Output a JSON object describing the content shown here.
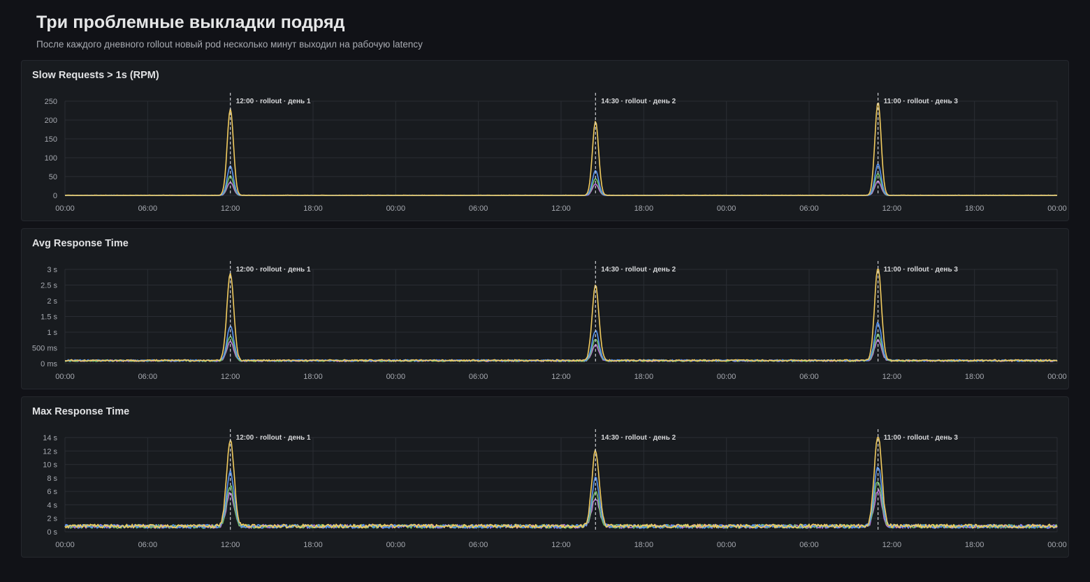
{
  "header": {
    "title": "Три проблемные выкладки подряд",
    "subtitle": "После каждого дневного rollout новый pod несколько минут выходил на рабочую latency"
  },
  "colors": {
    "background": "#111217",
    "panel": "#181b1f",
    "grid": "#2a2d33",
    "series": [
      "#f2cc60",
      "#5794f2",
      "#73bf69",
      "#b877d9"
    ]
  },
  "annotations": [
    {
      "x": 12,
      "label": "12:00 · rollout · день 1"
    },
    {
      "x": 38.5,
      "label": "14:30 · rollout · день 2"
    },
    {
      "x": 59,
      "label": "11:00 · rollout · день 3"
    }
  ],
  "x_ticks": [
    "00:00",
    "06:00",
    "12:00",
    "18:00",
    "00:00",
    "06:00",
    "12:00",
    "18:00",
    "00:00",
    "06:00",
    "12:00",
    "18:00",
    "00:00"
  ],
  "chart_data": [
    {
      "type": "line",
      "title": "Slow Requests > 1s (RPM)",
      "xlabel": "",
      "ylabel": "",
      "xlim": [
        0,
        72
      ],
      "ylim": [
        0,
        250
      ],
      "y_ticks": [
        {
          "v": 0,
          "label": "0"
        },
        {
          "v": 50,
          "label": "50"
        },
        {
          "v": 100,
          "label": "100"
        },
        {
          "v": 150,
          "label": "150"
        },
        {
          "v": 200,
          "label": "200"
        },
        {
          "v": 250,
          "label": "250"
        }
      ],
      "grid": true,
      "baseline": [
        0,
        0,
        0,
        0
      ],
      "noise": 0.6,
      "peaks": [
        [
          230,
          78,
          52,
          35
        ],
        [
          197,
          66,
          45,
          30
        ],
        [
          248,
          84,
          58,
          38
        ]
      ],
      "peak_width_h": 0.32
    },
    {
      "type": "line",
      "title": "Avg Response Time",
      "xlabel": "",
      "ylabel": "",
      "xlim": [
        0,
        72
      ],
      "ylim": [
        0,
        3
      ],
      "y_ticks": [
        {
          "v": 0,
          "label": "0 ms"
        },
        {
          "v": 0.5,
          "label": "500 ms"
        },
        {
          "v": 1,
          "label": "1 s"
        },
        {
          "v": 1.5,
          "label": "1.5 s"
        },
        {
          "v": 2,
          "label": "2 s"
        },
        {
          "v": 2.5,
          "label": "2.5 s"
        },
        {
          "v": 3,
          "label": "3 s"
        }
      ],
      "grid": true,
      "baseline": [
        0.1,
        0.1,
        0.09,
        0.09
      ],
      "noise": 0.025,
      "peaks": [
        [
          2.78,
          1.1,
          0.8,
          0.6
        ],
        [
          2.4,
          0.95,
          0.7,
          0.52
        ],
        [
          2.98,
          1.2,
          0.85,
          0.65
        ]
      ],
      "peak_width_h": 0.35
    },
    {
      "type": "line",
      "title": "Max Response Time",
      "xlabel": "",
      "ylabel": "",
      "xlim": [
        0,
        72
      ],
      "ylim": [
        0,
        14
      ],
      "y_ticks": [
        {
          "v": 0,
          "label": "0 s"
        },
        {
          "v": 2,
          "label": "2 s"
        },
        {
          "v": 4,
          "label": "4 s"
        },
        {
          "v": 6,
          "label": "6 s"
        },
        {
          "v": 8,
          "label": "8 s"
        },
        {
          "v": 10,
          "label": "10 s"
        },
        {
          "v": 12,
          "label": "12 s"
        },
        {
          "v": 14,
          "label": "14 s"
        }
      ],
      "grid": true,
      "baseline": [
        0.85,
        0.8,
        0.8,
        0.8
      ],
      "noise": 0.28,
      "peaks": [
        [
          13,
          8.2,
          6,
          5
        ],
        [
          11.2,
          7.2,
          5.2,
          4.2
        ],
        [
          13.8,
          9,
          6.8,
          5.3
        ]
      ],
      "peak_width_h": 0.38
    }
  ]
}
